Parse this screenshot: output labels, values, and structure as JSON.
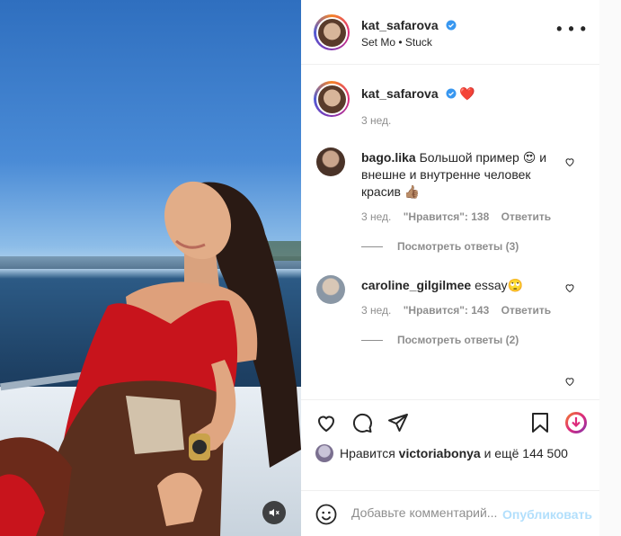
{
  "post": {
    "author": {
      "username": "kat_safarova",
      "audio_line": "Set Mo • Stuck"
    },
    "caption": {
      "username": "kat_safarova",
      "emoji": "❤️",
      "time": "3 нед."
    },
    "comments": [
      {
        "username": "bago.lika",
        "text": "Большой пример 😍 и внешне и внутренне человек красив 👍🏽",
        "time": "3 нед.",
        "likes": "\"Нравится\": 138",
        "reply": "Ответить",
        "view_replies": "Посмотреть ответы (3)"
      },
      {
        "username": "caroline_gilgilmee",
        "text": "essay🙄",
        "time": "3 нед.",
        "likes": "\"Нравится\": 143",
        "reply": "Ответить",
        "view_replies": "Посмотреть ответы (2)"
      }
    ],
    "likes": {
      "prefix": "Нравится",
      "user": "victoriabonya",
      "suffix": "и ещё 144 500"
    },
    "add_comment": {
      "placeholder": "Добавьте комментарий...",
      "publish": "Опубликовать"
    }
  },
  "icons": [
    "verified-badge-icon",
    "more-options-icon",
    "heart-icon",
    "comment-icon",
    "share-icon",
    "bookmark-icon",
    "download-icon",
    "emoji-icon",
    "mute-icon"
  ],
  "colors": {
    "verified": "#3897f0",
    "heart_red": "#ed4956",
    "publish_disabled": "#b2dffc",
    "secondary_text": "#8e8e8e"
  }
}
